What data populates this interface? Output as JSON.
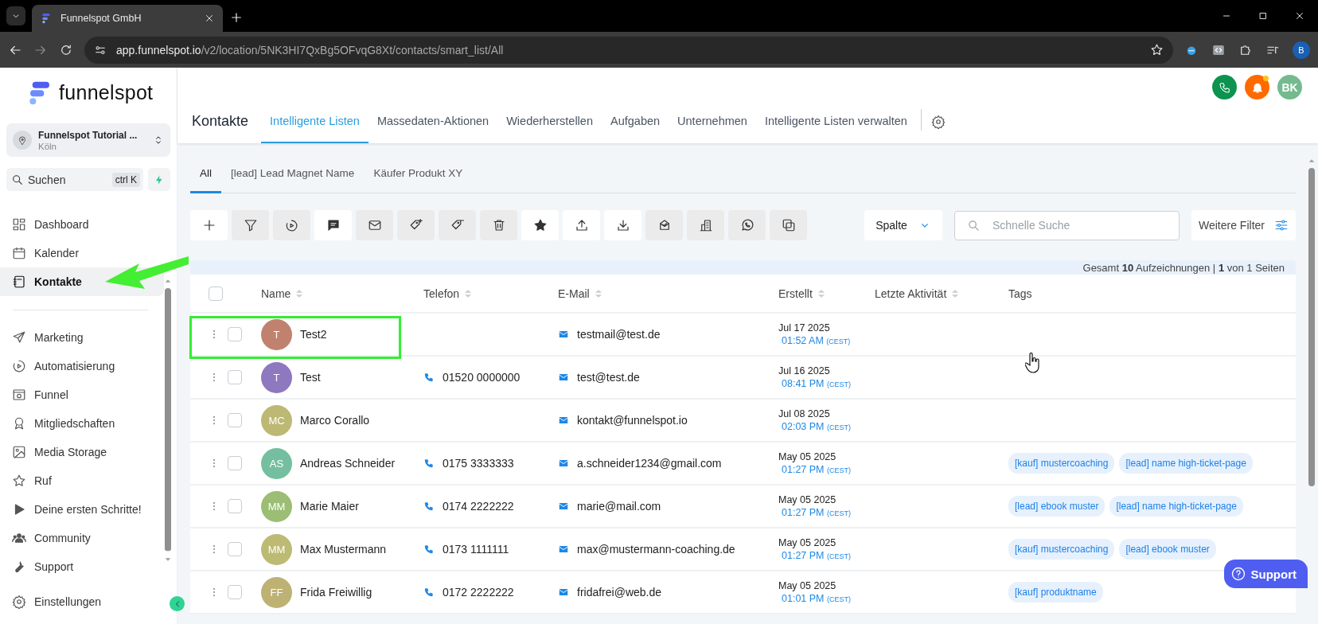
{
  "browser": {
    "tab_title": "Funnelspot GmbH",
    "url_host": "app.funnelspot.io",
    "url_path": "/v2/location/5NK3HI7QxBg5OFvqG8Xt/contacts/smart_list/All",
    "profile": "B"
  },
  "sidebar": {
    "logo": "funnelspot",
    "account": {
      "name": "Funnelspot Tutorial ...",
      "location": "Köln"
    },
    "search": {
      "label": "Suchen",
      "shortcut": "ctrl K"
    },
    "groups": [
      {
        "items": [
          {
            "label": "Dashboard",
            "kind": "dashboard",
            "selected": false
          },
          {
            "label": "Kalender",
            "kind": "calendar",
            "selected": false
          },
          {
            "label": "Kontakte",
            "kind": "contacts",
            "selected": true
          }
        ]
      },
      {
        "items": [
          {
            "label": "Marketing",
            "kind": "send",
            "selected": false
          },
          {
            "label": "Automatisierung",
            "kind": "automation",
            "selected": false
          },
          {
            "label": "Funnel",
            "kind": "funnel",
            "selected": false
          },
          {
            "label": "Mitgliedschaften",
            "kind": "award",
            "selected": false
          },
          {
            "label": "Media Storage",
            "kind": "image",
            "selected": false
          },
          {
            "label": "Ruf",
            "kind": "star",
            "selected": false
          },
          {
            "label": "Deine ersten Schritte!",
            "kind": "play",
            "selected": false
          },
          {
            "label": "Community",
            "kind": "people",
            "selected": false
          },
          {
            "label": "Support",
            "kind": "wrench",
            "selected": false
          }
        ]
      }
    ],
    "footer_item": {
      "label": "Einstellungen",
      "kind": "gear",
      "selected": false
    }
  },
  "header": {
    "user_initials": "BK",
    "title": "Kontakte",
    "tabs": [
      {
        "label": "Intelligente Listen",
        "selected": true
      },
      {
        "label": "Massedaten-Aktionen",
        "selected": false
      },
      {
        "label": "Wiederherstellen",
        "selected": false
      },
      {
        "label": "Aufgaben",
        "selected": false
      },
      {
        "label": "Unternehmen",
        "selected": false
      },
      {
        "label": "Intelligente Listen verwalten",
        "selected": false
      }
    ]
  },
  "list_tabs": [
    {
      "label": "All",
      "selected": true
    },
    {
      "label": "[lead] Lead Magnet Name",
      "selected": false
    },
    {
      "label": "Käufer Produkt XY",
      "selected": false
    }
  ],
  "toolbar": [
    {
      "kind": "add",
      "disabled": false
    },
    {
      "kind": "filter",
      "disabled": true
    },
    {
      "kind": "automation",
      "disabled": true
    },
    {
      "kind": "chat",
      "disabled": false
    },
    {
      "kind": "mail",
      "disabled": true
    },
    {
      "kind": "tag-add",
      "disabled": true
    },
    {
      "kind": "tag-remove",
      "disabled": true
    },
    {
      "kind": "trash",
      "disabled": true
    },
    {
      "kind": "star",
      "disabled": false
    },
    {
      "kind": "upload",
      "disabled": false
    },
    {
      "kind": "download",
      "disabled": false
    },
    {
      "kind": "inbox",
      "disabled": true
    },
    {
      "kind": "building",
      "disabled": true
    },
    {
      "kind": "whatsapp",
      "disabled": true
    },
    {
      "kind": "copy",
      "disabled": true
    }
  ],
  "columns_button": "Spalte",
  "quick_search": {
    "placeholder": "Schnelle Suche"
  },
  "more_filters": "Weitere Filter",
  "summary": "Gesamt **10** Aufzeichnungen | **1** von 1 Seiten",
  "table": {
    "select_all": {
      "checked": false
    },
    "columns": [
      {
        "label": "Name",
        "sortable": true
      },
      {
        "label": "Telefon",
        "sortable": true
      },
      {
        "label": "E-Mail",
        "sortable": true
      },
      {
        "label": "Erstellt",
        "sortable": true
      },
      {
        "label": "Letzte Aktivität",
        "sortable": true
      },
      {
        "label": "Tags",
        "sortable": false
      }
    ],
    "rows": [
      {
        "checked": false,
        "initials": "T",
        "color": "#c0826f",
        "name": "Test2",
        "email": "testmail@test.de",
        "date": "Jul 17 2025",
        "time": "01:52 AM",
        "zone": "(CEST)"
      },
      {
        "checked": false,
        "initials": "T",
        "color": "#8e78c0",
        "name": "Test",
        "phone": "01520 0000000",
        "email": "test@test.de",
        "date": "Jul 16 2025",
        "time": "08:41 PM",
        "zone": "(CEST)"
      },
      {
        "checked": false,
        "initials": "MC",
        "color": "#bdb874",
        "name": "Marco Corallo",
        "email": "kontakt@funnelspot.io",
        "date": "Jul 08 2025",
        "time": "02:03 PM",
        "zone": "(CEST)"
      },
      {
        "checked": false,
        "initials": "AS",
        "color": "#74bf9f",
        "name": "Andreas Schneider",
        "phone": "0175 3333333",
        "email": "a.schneider1234@gmail.com",
        "date": "May 05 2025",
        "time": "01:27 PM",
        "zone": "(CEST)",
        "tags": [
          "[kauf] mustercoaching",
          "[lead] name high-ticket-page"
        ]
      },
      {
        "checked": false,
        "initials": "MM",
        "color": "#9cbd74",
        "name": "Marie Maier",
        "phone": "0174 2222222",
        "email": "marie@mail.com",
        "date": "May 05 2025",
        "time": "01:27 PM",
        "zone": "(CEST)",
        "tags": [
          "[lead] ebook muster",
          "[lead] name high-ticket-page"
        ]
      },
      {
        "checked": false,
        "initials": "MM",
        "color": "#bdba74",
        "name": "Max Mustermann",
        "phone": "0173 1111111",
        "email": "max@mustermann-coaching.de",
        "date": "May 05 2025",
        "time": "01:27 PM",
        "zone": "(CEST)",
        "tags": [
          "[kauf] mustercoaching",
          "[lead] ebook muster"
        ]
      },
      {
        "checked": false,
        "initials": "FF",
        "color": "#bdb274",
        "name": "Frida Freiwillig",
        "phone": "0172 2222222",
        "email": "fridafrei@web.de",
        "date": "May 05 2025",
        "time": "01:01 PM",
        "zone": "(CEST)",
        "tags": [
          "[kauf] produktname"
        ]
      }
    ]
  },
  "support_button": "Support"
}
